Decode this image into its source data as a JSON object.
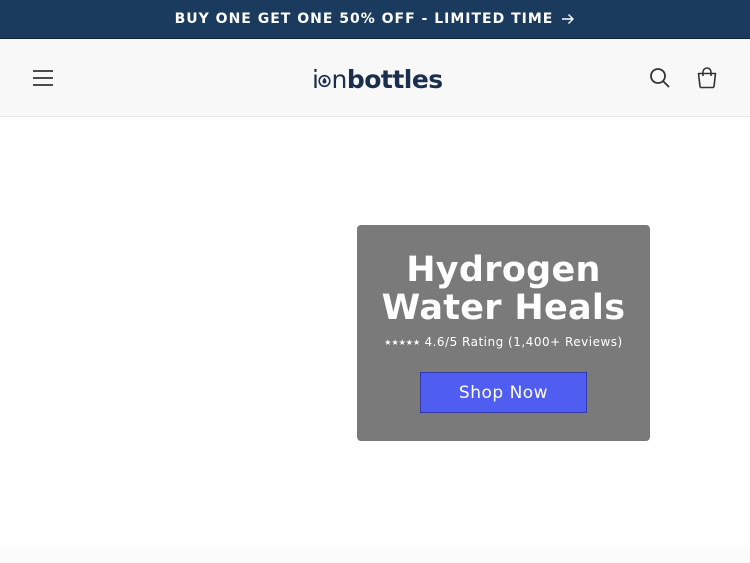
{
  "announcement": {
    "text": "BUY ONE GET ONE 50% OFF - LIMITED TIME",
    "arrow_icon": "arrow-right-icon",
    "background": "#1a3a5e"
  },
  "header": {
    "menu_icon": "hamburger-menu-icon",
    "logo": {
      "light": "i",
      "bold": "bottles",
      "light_after_drop": "n"
    },
    "search_icon": "search-icon",
    "cart_icon": "cart-icon"
  },
  "hero": {
    "title_line1": "Hydrogen",
    "title_line2": "Water Heals",
    "stars": "★★★★★",
    "rating_text": "4.6/5 Rating (1,400+ Reviews)",
    "cta_label": "Shop Now",
    "card_color": "#7a7a7a",
    "cta_color": "#4f5ef0"
  }
}
